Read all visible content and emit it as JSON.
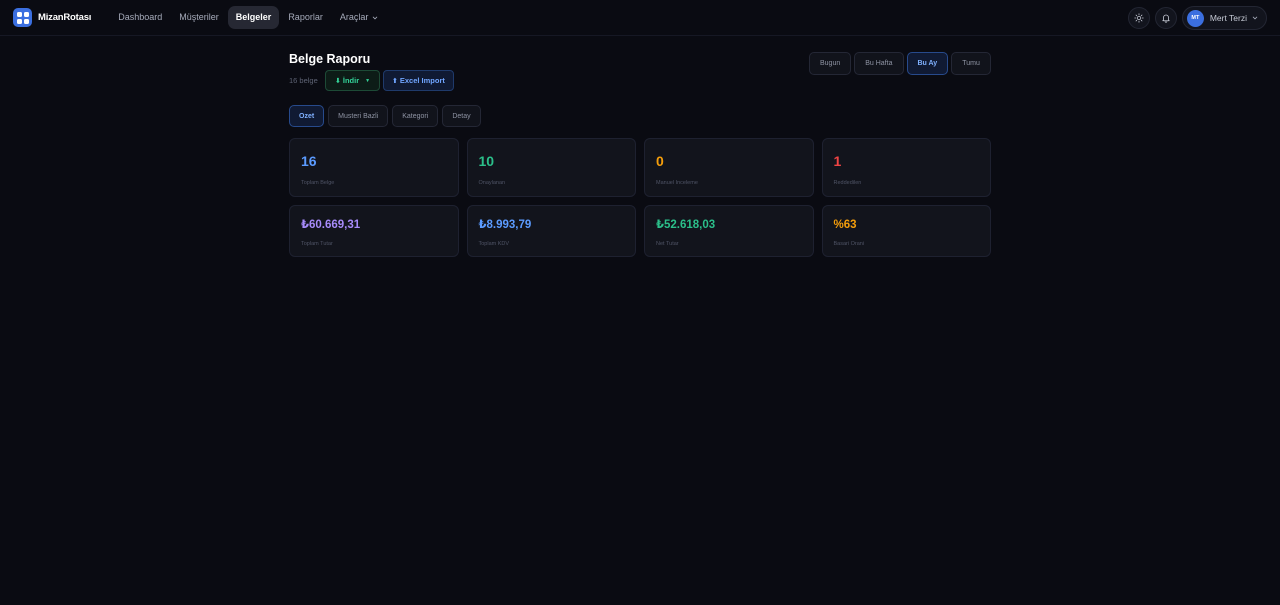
{
  "app": {
    "brand_name": "MizanRotası"
  },
  "nav": {
    "items": [
      {
        "label": "Dashboard"
      },
      {
        "label": "Müşteriler"
      },
      {
        "label": "Belgeler",
        "active": true
      },
      {
        "label": "Raporlar"
      },
      {
        "label": "Araçlar"
      }
    ]
  },
  "user": {
    "initials": "MT",
    "name": "Mert Terzi"
  },
  "page": {
    "title": "Belge Raporu",
    "doc_count": "16 belge",
    "download_label": "İndir",
    "import_label": "Excel Import"
  },
  "range": {
    "options": [
      {
        "label": "Bugun"
      },
      {
        "label": "Bu Hafta"
      },
      {
        "label": "Bu Ay",
        "active": true
      },
      {
        "label": "Tumu"
      }
    ]
  },
  "tabs": [
    {
      "label": "Ozet",
      "active": true
    },
    {
      "label": "Musteri Bazli"
    },
    {
      "label": "Kategori"
    },
    {
      "label": "Detay"
    }
  ],
  "stats": [
    {
      "value": "16",
      "label": "Toplam Belge",
      "color": "#5b9bff"
    },
    {
      "value": "10",
      "label": "Onaylanan",
      "color": "#2bbf8a"
    },
    {
      "value": "0",
      "label": "Manuel Inceleme",
      "color": "#f59e0b"
    },
    {
      "value": "1",
      "label": "Reddedilen",
      "color": "#ef4444"
    }
  ],
  "totals": [
    {
      "value": "₺60.669,31",
      "label": "Toplam Tutar",
      "color": "#a78bfa"
    },
    {
      "value": "₺8.993,79",
      "label": "Toplam KDV",
      "color": "#5b9bff"
    },
    {
      "value": "₺52.618,03",
      "label": "Net Tutar",
      "color": "#2bbf8a"
    },
    {
      "value": "%63",
      "label": "Basari Orani",
      "color": "#f59e0b"
    }
  ]
}
